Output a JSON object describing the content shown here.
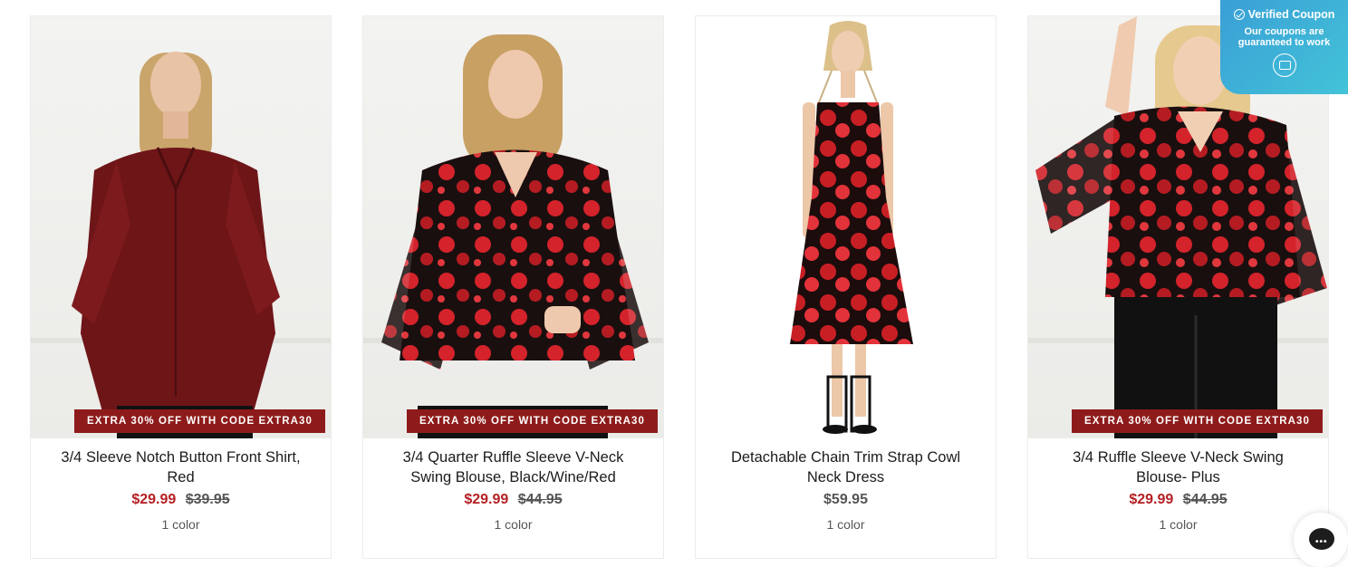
{
  "products": [
    {
      "badge": "EXTRA 30% OFF WITH CODE EXTRA30",
      "title": "3/4 Sleeve Notch Button Front Shirt, Red",
      "sale_price": "$29.99",
      "original_price": "$39.95",
      "colors": "1 color"
    },
    {
      "badge": "EXTRA 30% OFF WITH CODE EXTRA30",
      "title": "3/4 Quarter Ruffle Sleeve V-Neck Swing Blouse, Black/Wine/Red",
      "sale_price": "$29.99",
      "original_price": "$44.95",
      "colors": "1 color"
    },
    {
      "title": "Detachable Chain Trim Strap Cowl Neck Dress",
      "price": "$59.95",
      "colors": "1 color"
    },
    {
      "badge": "EXTRA 30% OFF WITH CODE EXTRA30",
      "title": "3/4 Ruffle Sleeve V-Neck Swing Blouse- Plus",
      "sale_price": "$29.99",
      "original_price": "$44.95",
      "colors": "1 color"
    }
  ],
  "coupon": {
    "title": "Verified Coupon",
    "subtitle": "Our coupons are guaranteed to work",
    "icon": "coupon-chip-icon"
  },
  "chat": {
    "icon": "chat-bubble-icon",
    "dots": "•••"
  },
  "colors": {
    "badge_bg": "#8e1b1b",
    "sale_price": "#b41f24",
    "coupon_gradient_start": "#3a9fd6",
    "coupon_gradient_end": "#43c3d8"
  }
}
